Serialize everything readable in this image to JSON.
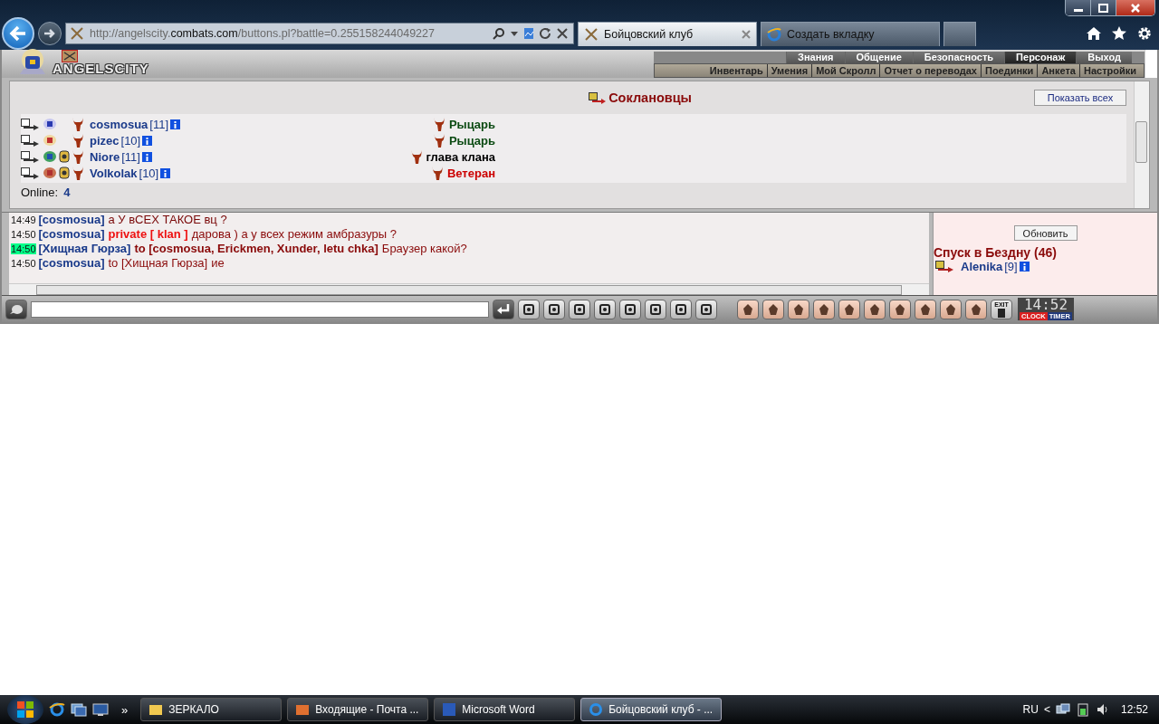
{
  "browser": {
    "url_prefix": "http://angelscity.",
    "url_domain": "combats.com",
    "url_suffix": "/buttons.pl?battle=0.255158244049227",
    "tabs": [
      {
        "label": "Бойцовский клуб",
        "selected": true
      },
      {
        "label": "Создать вкладку",
        "selected": false
      }
    ]
  },
  "game": {
    "logo": "ANGELSCITY",
    "menu": [
      {
        "label": "Знания",
        "selected": false
      },
      {
        "label": "Общение",
        "selected": false
      },
      {
        "label": "Безопасность",
        "selected": false
      },
      {
        "label": "Персонаж",
        "selected": true
      },
      {
        "label": "Выход",
        "selected": false
      }
    ],
    "submenu": [
      "Инвентарь",
      "Умения",
      "Мой Скролл",
      "Отчет о переводах",
      "Поединки",
      "Анкета",
      "Настройки"
    ],
    "clan": {
      "title": "Соклановцы",
      "show_all": "Показать всех",
      "members": [
        {
          "name": "cosmosua",
          "level": "[11]",
          "medal": false,
          "rank": "Рыцарь",
          "color": "#0b4a12"
        },
        {
          "name": "pizec",
          "level": "[10]",
          "medal": false,
          "rank": "Рыцарь",
          "color": "#0b4a12"
        },
        {
          "name": "Niore",
          "level": "[11]",
          "medal": true,
          "rank": "глава клана",
          "color": "#000000"
        },
        {
          "name": "Volkolak",
          "level": "[10]",
          "medal": true,
          "rank": "Ветеран",
          "color": "#cc0000"
        }
      ],
      "online_label": "Online:",
      "online_count": "4"
    },
    "chat": [
      {
        "time": "14:49",
        "highlight": false,
        "sender": "[cosmosua]",
        "kind": "say",
        "message": "а У вСЕХ ТАКОЕ вц ?"
      },
      {
        "time": "14:50",
        "highlight": false,
        "sender": "[cosmosua]",
        "kind": "private",
        "target": "private [ klan ]",
        "message": "дарова ) а у всех режим амбразуры ?"
      },
      {
        "time": "14:50",
        "highlight": true,
        "sender": "[Хищная Гюрза]",
        "kind": "to_me",
        "target": "to [cosmosua, Erickmen, Xunder, letu chka]",
        "message": "Браузер какой?"
      },
      {
        "time": "14:50",
        "highlight": false,
        "sender": "[cosmosua]",
        "kind": "to",
        "target": "to [Хищная Гюрза]",
        "message": "ие"
      }
    ],
    "room": {
      "refresh": "Обновить",
      "title": "Спуск в Бездну (46)",
      "member_name": "Alenika",
      "member_level": "[9]"
    },
    "toolbar": {
      "exit_label": "EXIT",
      "clock": "14:52",
      "modes": [
        {
          "label": "CLOCK",
          "selected": true
        },
        {
          "label": "TIMER",
          "selected": false
        }
      ]
    }
  },
  "taskbar": {
    "more": "»",
    "tasks": [
      {
        "label": "ЗЕРКАЛО",
        "kind": "folder",
        "selected": false
      },
      {
        "label": "Входящие - Почта ...",
        "kind": "mail",
        "selected": false
      },
      {
        "label": "Microsoft Word",
        "kind": "word",
        "selected": false
      },
      {
        "label": "Бойцовский клуб - ...",
        "kind": "browser",
        "selected": true
      }
    ],
    "language": "RU",
    "expand": "<",
    "time": "12:52"
  }
}
